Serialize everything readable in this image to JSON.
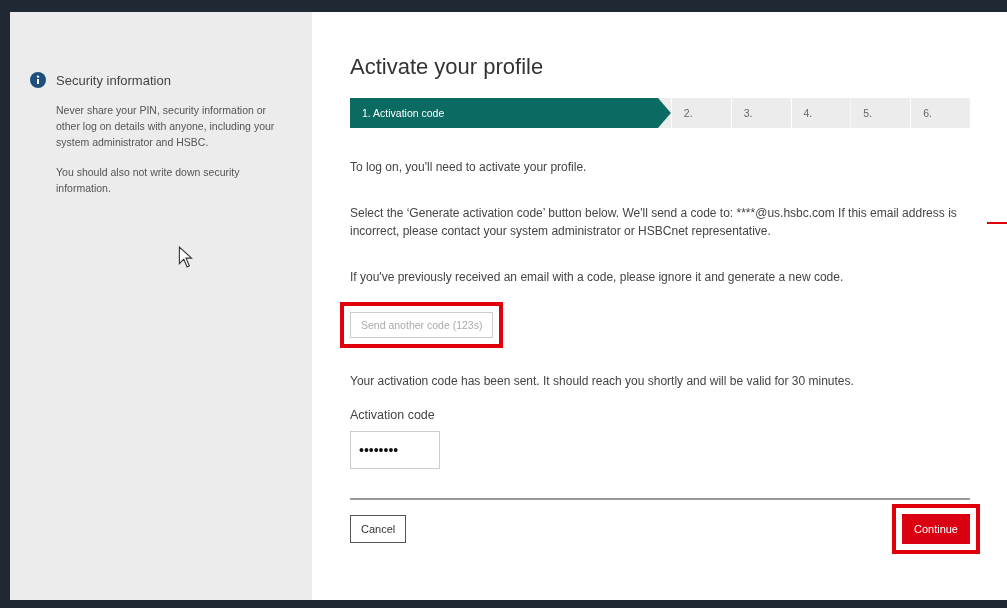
{
  "sidebar": {
    "title": "Security information",
    "paragraphs": [
      "Never share your PIN, security information or other log on details with anyone, including your system administrator and HSBC.",
      "You should also not write down security information."
    ]
  },
  "main": {
    "title": "Activate your profile",
    "steps": [
      {
        "label": "1. Activation code",
        "selected": true
      },
      {
        "label": "2.",
        "selected": false
      },
      {
        "label": "3.",
        "selected": false
      },
      {
        "label": "4.",
        "selected": false
      },
      {
        "label": "5.",
        "selected": false
      },
      {
        "label": "6.",
        "selected": false
      }
    ],
    "paragraphs": [
      "To log on, you'll need to activate your profile.",
      "Select the ‘Generate activation code’ button below. We'll send a code to: ****@us.hsbc.com If this email address is incorrect, please contact your system administrator or HSBCnet representative.",
      "If you've previously received an email with a code, please ignore it and generate a new code."
    ],
    "send_button": {
      "label": "Send another code (123s)",
      "disabled": true,
      "highlighted": true
    },
    "sent_message": "Your activation code has been sent. It should reach you shortly and will be valid for 30 minutes.",
    "code_field": {
      "label": "Activation code",
      "value": "••••••••"
    },
    "cancel_button": {
      "label": "Cancel"
    },
    "continue_button": {
      "label": "Continue",
      "highlighted": true
    }
  }
}
